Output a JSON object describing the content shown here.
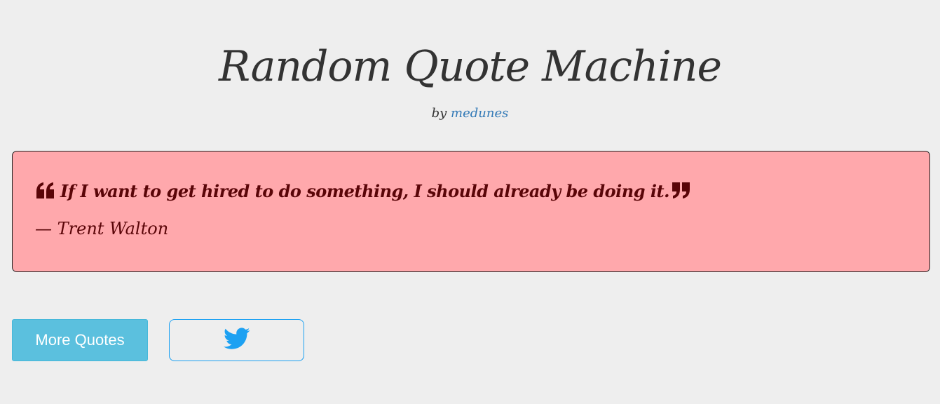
{
  "header": {
    "title": "Random Quote Machine",
    "by_prefix": "by",
    "author_link": "medunes",
    "link_color": "#337ab7"
  },
  "quote": {
    "text": "If I want to get hired to do something, I should already be doing it.",
    "author": "— Trent Walton",
    "open_quote_icon": "quote-left-icon",
    "close_quote_icon": "quote-right-icon",
    "background_color": "#ffa8ac",
    "text_color": "#5a0508"
  },
  "actions": {
    "more_quotes_label": "More Quotes",
    "more_quotes_color": "#5bc0de",
    "tweet_icon": "twitter-icon",
    "tweet_color": "#1da1f2"
  }
}
